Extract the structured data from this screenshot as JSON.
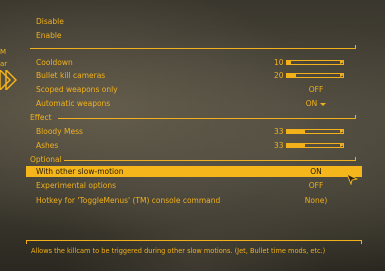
{
  "top_items": [
    "Disable",
    "Enable"
  ],
  "rows_main": [
    {
      "label": "Cooldown",
      "value": "10",
      "type": "slider",
      "fraction": 0.08
    },
    {
      "label": "Bullet kill cameras",
      "value": "20",
      "type": "slider",
      "fraction": 0.16
    },
    {
      "label": "Scoped weapons only",
      "value": "OFF",
      "type": "text"
    },
    {
      "label": "Automatic weapons",
      "value": "ON",
      "type": "dropdown"
    }
  ],
  "section_effect": "Effect",
  "rows_effect": [
    {
      "label": "Bloody Mess",
      "value": "33",
      "type": "slider",
      "fraction": 0.33
    },
    {
      "label": "Ashes",
      "value": "33",
      "type": "slider",
      "fraction": 0.33
    }
  ],
  "section_optional": "Optional",
  "rows_optional": [
    {
      "label": "With other slow-motion",
      "value": "ON",
      "type": "text",
      "selected": true
    },
    {
      "label": "Experimental options",
      "value": "OFF",
      "type": "text"
    },
    {
      "label": "Hotkey for 'ToggleMenus' (TM) console command",
      "value": "None)",
      "type": "text"
    }
  ],
  "description": "Allows the killcam to be triggered during other slow motions. (Jet, Bullet time mods, etc.)",
  "edge_labels": [
    "M",
    "ar"
  ],
  "colors": {
    "accent": "#f2b11a",
    "highlight": "#f5b61c"
  }
}
